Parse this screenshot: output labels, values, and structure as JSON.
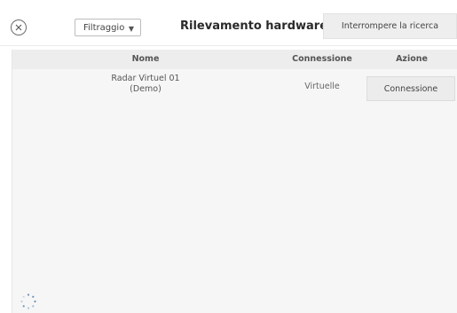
{
  "header": {
    "close_icon": "close-circle-icon",
    "filter_label": "Filtraggio",
    "filter_caret_icon": "caret-down-icon",
    "title": "Rilevamento hardware",
    "stop_label": "Interrompere la ricerca"
  },
  "table": {
    "columns": [
      "Nome",
      "Connessione",
      "Azione"
    ],
    "rows": [
      {
        "name_line1": "Radar Virtuel 01",
        "name_line2": "(Demo)",
        "connection": "Virtuelle",
        "action_label": "Connessione"
      }
    ]
  },
  "status": {
    "loading_icon": "loading-spinner-icon"
  }
}
